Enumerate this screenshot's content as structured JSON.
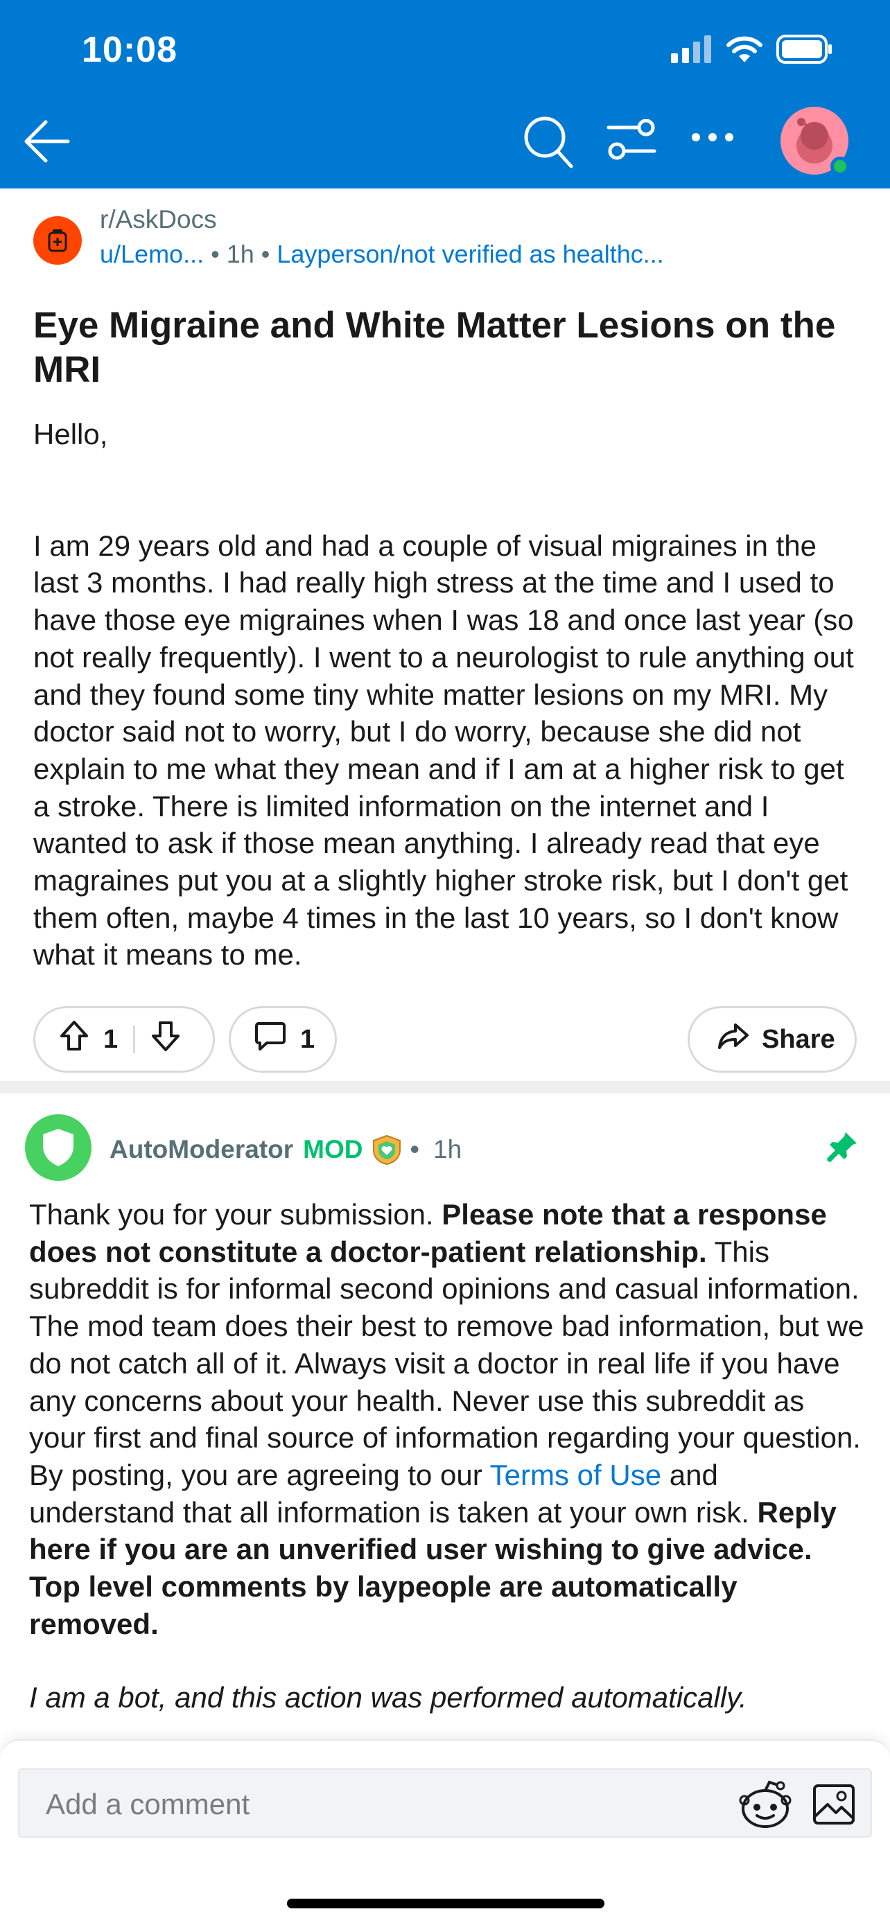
{
  "status_bar": {
    "time": "10:08",
    "icons": [
      "cellular-signal-icon",
      "wifi-icon",
      "battery-icon"
    ]
  },
  "nav": {
    "icons": [
      "back-arrow-icon",
      "search-icon",
      "filter-icon",
      "more-icon",
      "user-avatar"
    ]
  },
  "post": {
    "subreddit": "r/AskDocs",
    "author": "u/Lemo...",
    "age": "1h",
    "flair": "Layperson/not verified as healthc...",
    "title": "Eye Migraine and White Matter Lesions on the MRI",
    "greeting": "Hello,",
    "body": "I am 29 years old and had a couple of visual migraines in the last 3 months. I had really high stress at the time and I used to have those eye migraines when I was 18 and once last year (so not really frequently). I went to a neurologist to rule anything out and they found some tiny white matter lesions on my MRI. My doctor said not to worry, but I do worry, because she did not explain to me what they mean and if I am at a higher risk to get a stroke. There is limited information on the internet and I wanted to ask if those mean anything. I already read that eye magraines put you at a slightly higher stroke risk, but I don't get them often, maybe 4 times in the last 10 years, so I don't know what it means to me.",
    "upvotes": "1",
    "comments": "1",
    "share_label": "Share"
  },
  "comment": {
    "author": "AutoModerator",
    "mod_tag": "MOD",
    "age": "1h",
    "body_1": "Thank you for your submission. ",
    "body_bold_1": "Please note that a response does not constitute a doctor-patient relationship.",
    "body_2": " This subreddit is for informal second opinions and casual information. The mod team does their best to remove bad information, but we do not catch all of it. Always visit a doctor in real life if you have any concerns about your health. Never use this subreddit as your first and final source of information regarding your question. By posting, you are agreeing to our ",
    "body_link": "Terms of Use",
    "body_3": " and understand that all information is taken at your own risk. ",
    "body_bold_2": "Reply here if you are an unverified user wishing to give advice. Top level comments by laypeople are automatically removed.",
    "bot_note": "I am a bot, and this action was performed automatically."
  },
  "composer": {
    "placeholder": "Add a comment"
  },
  "colors": {
    "header_blue": "#0079d3",
    "subreddit_orange": "#ff4500",
    "mod_green": "#00c06e"
  }
}
